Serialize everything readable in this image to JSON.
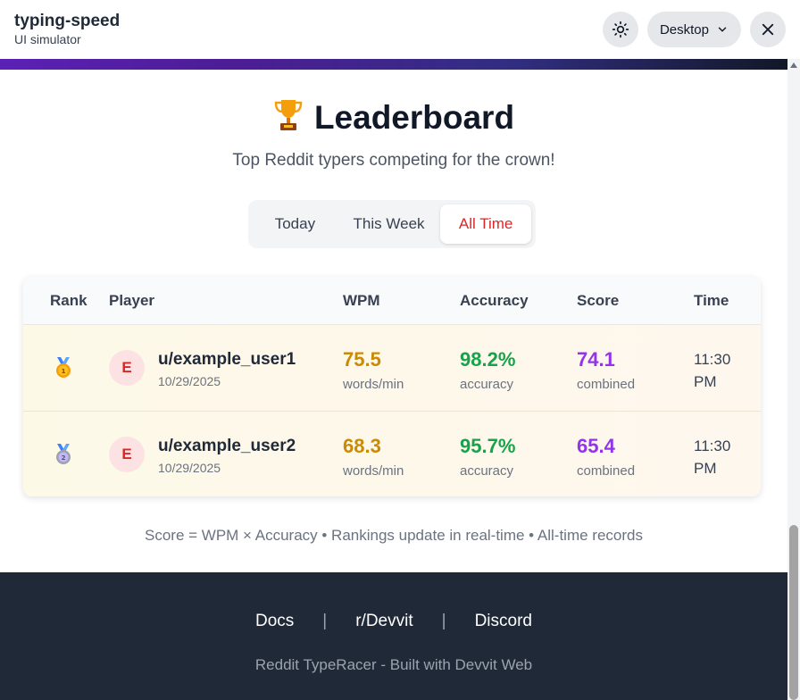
{
  "app": {
    "title": "typing-speed",
    "subtitle": "UI simulator"
  },
  "toolbar": {
    "theme_icon": "sun-icon",
    "device_label": "Desktop",
    "close_icon": "close-icon"
  },
  "leaderboard": {
    "title": "Leaderboard",
    "title_icon": "trophy-icon",
    "subtitle": "Top Reddit typers competing for the crown!",
    "tabs": [
      {
        "label": "Today",
        "active": false
      },
      {
        "label": "This Week",
        "active": false
      },
      {
        "label": "All Time",
        "active": true
      }
    ],
    "columns": [
      "Rank",
      "Player",
      "WPM",
      "Accuracy",
      "Score",
      "Time"
    ],
    "rows": [
      {
        "rank_icon": "gold-medal-icon",
        "avatar": "E",
        "name": "u/example_user1",
        "date": "10/29/2025",
        "wpm": "75.5",
        "wpm_unit": "words/min",
        "accuracy": "98.2%",
        "accuracy_unit": "accuracy",
        "score": "74.1",
        "score_unit": "combined",
        "time": "11:30 PM"
      },
      {
        "rank_icon": "silver-medal-icon",
        "avatar": "E",
        "name": "u/example_user2",
        "date": "10/29/2025",
        "wpm": "68.3",
        "wpm_unit": "words/min",
        "accuracy": "95.7%",
        "accuracy_unit": "accuracy",
        "score": "65.4",
        "score_unit": "combined",
        "time": "11:30 PM"
      }
    ],
    "footnote": "Score = WPM × Accuracy • Rankings update in real-time • All-time records"
  },
  "footer": {
    "links": [
      "Docs",
      "r/Devvit",
      "Discord"
    ],
    "separator": "|",
    "text": "Reddit TypeRacer - Built with Devvit Web"
  },
  "colors": {
    "accent": "#dc2626",
    "wpm": "#ca8a04",
    "accuracy": "#16a34a",
    "score": "#9333ea",
    "footer_bg": "#1f2937"
  }
}
